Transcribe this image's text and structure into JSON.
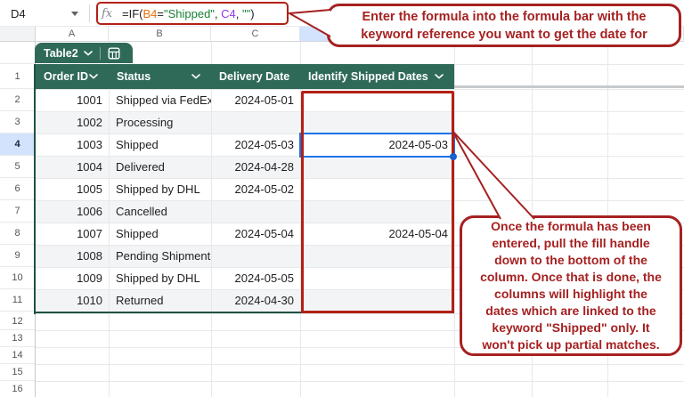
{
  "toolbar": {
    "name_box_value": "D4",
    "fx_icon": "fx",
    "formula": "=IF(B4=\"Shipped\", C4, \"\")",
    "formula_parts": [
      {
        "text": "=IF(",
        "color": "#202124"
      },
      {
        "text": "B4",
        "color": "#E8710A"
      },
      {
        "text": "=",
        "color": "#202124"
      },
      {
        "text": "\"Shipped\"",
        "color": "#188038"
      },
      {
        "text": ", ",
        "color": "#202124"
      },
      {
        "text": "C4",
        "color": "#9334E6"
      },
      {
        "text": ", ",
        "color": "#202124"
      },
      {
        "text": "\"\"",
        "color": "#188038"
      },
      {
        "text": ")",
        "color": "#202124"
      }
    ]
  },
  "sheet": {
    "column_letters": [
      "A",
      "B",
      "C"
    ],
    "row_numbers": [
      "1",
      "2",
      "3",
      "4",
      "5",
      "6",
      "7",
      "8",
      "9",
      "10",
      "11",
      "12",
      "13",
      "14",
      "15",
      "16"
    ],
    "selected_cell": "D4"
  },
  "table": {
    "name": "Table2",
    "headers": [
      "Order ID",
      "Status",
      "Delivery Date",
      "Identify Shipped Dates"
    ],
    "rows": [
      {
        "order_id": "1001",
        "status": "Shipped via FedEx",
        "delivery_date": "2024-05-01",
        "identified": ""
      },
      {
        "order_id": "1002",
        "status": "Processing",
        "delivery_date": "",
        "identified": ""
      },
      {
        "order_id": "1003",
        "status": "Shipped",
        "delivery_date": "2024-05-03",
        "identified": "2024-05-03"
      },
      {
        "order_id": "1004",
        "status": "Delivered",
        "delivery_date": "2024-04-28",
        "identified": ""
      },
      {
        "order_id": "1005",
        "status": "Shipped by DHL",
        "delivery_date": "2024-05-02",
        "identified": ""
      },
      {
        "order_id": "1006",
        "status": "Cancelled",
        "delivery_date": "",
        "identified": ""
      },
      {
        "order_id": "1007",
        "status": "Shipped",
        "delivery_date": "2024-05-04",
        "identified": "2024-05-04"
      },
      {
        "order_id": "1008",
        "status": "Pending Shipment",
        "delivery_date": "",
        "identified": ""
      },
      {
        "order_id": "1009",
        "status": "Shipped by DHL",
        "delivery_date": "2024-05-05",
        "identified": ""
      },
      {
        "order_id": "1010",
        "status": "Returned",
        "delivery_date": "2024-04-30",
        "identified": ""
      }
    ]
  },
  "callouts": {
    "formula_note": "Enter the formula into the formula bar with the\nkeyword reference you want to get the date for",
    "fill_note": "Once the formula has been\nentered, pull the fill handle\ndown to the bottom of the\ncolumn. Once that is done, the\ncolumns will highlight the\ndates which are linked to the\nkeyword \"Shipped\" only. It\nwon't pick up partial matches."
  },
  "colors": {
    "table_green": "#2F6A58",
    "table_border_green": "#1F5244",
    "annotation_red": "#A62121",
    "highlight_red": "#B22015",
    "selection_blue": "#1A73E8",
    "selected_header_bg": "#D3E3FD",
    "band_gray": "#F3F4F6",
    "ref_orange": "#E8710A",
    "string_green": "#188038",
    "ref_purple": "#9334E6"
  }
}
